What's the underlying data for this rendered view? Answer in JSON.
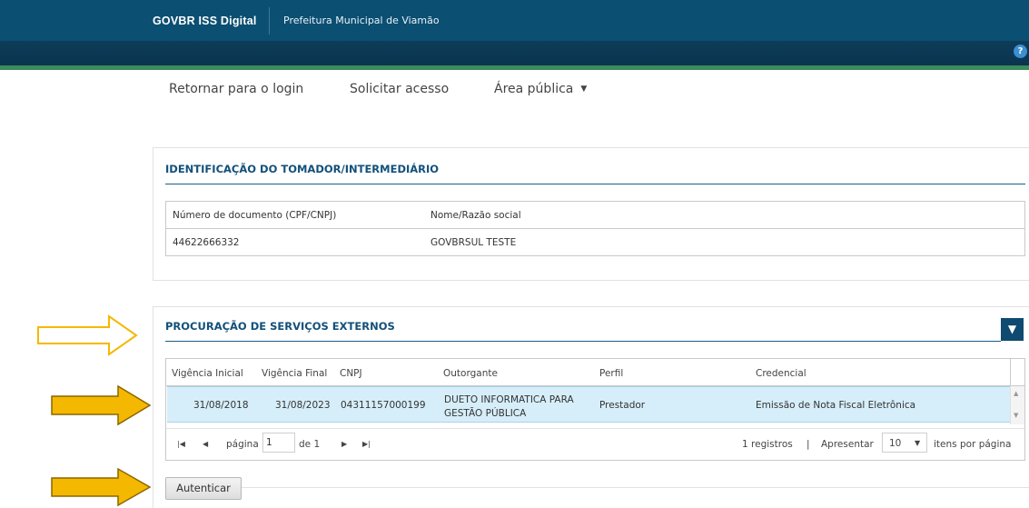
{
  "header": {
    "brand": "GOVBR ISS Digital",
    "municipality": "Prefeitura Municipal de Viamão",
    "help_label": "?"
  },
  "nav": {
    "items": [
      {
        "label": "Retornar para o login"
      },
      {
        "label": "Solicitar acesso"
      },
      {
        "label": "Área pública"
      }
    ]
  },
  "identification": {
    "title": "IDENTIFICAÇÃO DO TOMADOR/INTERMEDIÁRIO",
    "columns": [
      "Número de documento (CPF/CNPJ)",
      "Nome/Razão social"
    ],
    "row": [
      "44622666332",
      "GOVBRSUL TESTE"
    ]
  },
  "procuracao": {
    "title": "PROCURAÇÃO DE SERVIÇOS EXTERNOS",
    "columns": [
      "Vigência Inicial",
      "Vigência Final",
      "CNPJ",
      "Outorgante",
      "Perfil",
      "Credencial"
    ],
    "rows": [
      {
        "vigencia_inicial": "31/08/2018",
        "vigencia_final": "31/08/2023",
        "cnpj": "04311157000199",
        "outorgante_line1": "DUETO INFORMATICA PARA",
        "outorgante_line2": "GESTÃO PÚBLICA",
        "perfil": "Prestador",
        "credencial": "Emissão de Nota Fiscal Eletrônica"
      }
    ],
    "pager": {
      "page_label": "página",
      "page_value": "1",
      "of_label": "de 1",
      "records": "1 registros",
      "separator": "|",
      "show_label": "Apresentar",
      "per_page": "10",
      "per_page_label": "itens por página"
    }
  },
  "actions": {
    "authenticate": "Autenticar"
  },
  "colors": {
    "header_bg": "#0b4f72",
    "accent_line": "#3b8a5a",
    "section_title": "#12507a",
    "selected_row": "#d6eefa",
    "arrow_fill": "#f5b800",
    "arrow_outline_only": "#f5b800"
  }
}
